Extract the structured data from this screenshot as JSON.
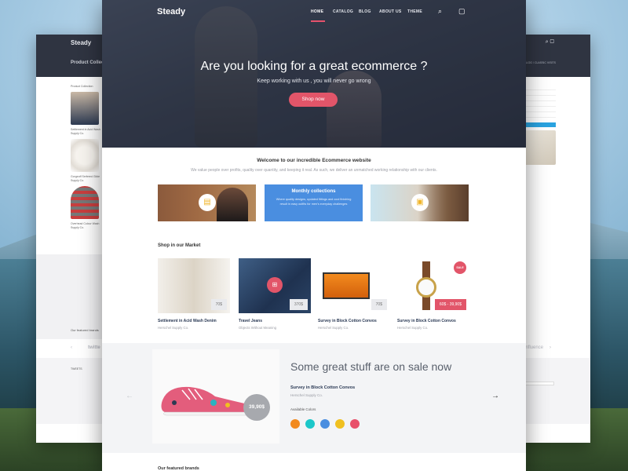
{
  "back_page": {
    "logo": "Steady",
    "title": "Product Collection",
    "icons": "⌕ ▢",
    "breadcrumb": "HOME / BLOG / CLASSIC VISITS",
    "left_label": "Product Collection",
    "items": [
      {
        "name": "Settlement in Acid Wash",
        "brand": "Supply Co."
      },
      {
        "name": "Gorgeoff Serfered Glide",
        "brand": "Supply Co."
      },
      {
        "name": "Overhead Colour Wash",
        "brand": "Supply Co."
      }
    ],
    "brands_label": "Our featured brands",
    "brand_left": "twitte",
    "brand_right": "influence",
    "footer_label": "TWEETS"
  },
  "nav": {
    "logo": "Steady",
    "items": [
      "HOME",
      "CATALOG",
      "BLOG",
      "ABOUT US",
      "THEME"
    ],
    "search_icon": "⌕",
    "bag_icon": "▢"
  },
  "hero": {
    "title": "Are you looking for a great ecommerce ?",
    "subtitle": "Keep working with us , you will never go wrong",
    "button": "Shop now"
  },
  "welcome": {
    "title": "Welcome to our incredible Ecommerce website",
    "text": "We value people over profits, quality over quantity, and keeping it real. As such, we deliver an unmatched working relationship with our clients."
  },
  "features": {
    "left_icon": "▤",
    "middle_title": "Monthly collections",
    "middle_text": "Where quality designs, updated fittings and cool finishing result in easy outfits for men's everyday challenges",
    "right_icon": "▣"
  },
  "market": {
    "label": "Shop in our Market",
    "products": [
      {
        "name": "Settlement in Acid Wash Denim",
        "brand": "Herschel Supply Co.",
        "price": "70$"
      },
      {
        "name": "Travel Jeans",
        "brand": "Objects Without Meaning",
        "price": "370$"
      },
      {
        "name": "Survey in Block Cotton Convos",
        "brand": "Herschel Supply Co.",
        "price": "70$"
      },
      {
        "name": "Survey in Block Cotton Convos",
        "brand": "Herschel Supply Co.",
        "price": "60$ - 39,90$"
      }
    ],
    "sale_badge": "SALE",
    "cart_icon": "⊞"
  },
  "sale": {
    "title": "Some great stuff are on sale now",
    "product": "Survey in Block Cotton Convos",
    "brand": "Herschel Supply Co.",
    "colors_label": "Available Colors",
    "price": "39,90$",
    "prev_arrow": "←",
    "next_arrow": "→",
    "colors": [
      "#f28a1f",
      "#1cc7c9",
      "#4a8ee0",
      "#f0c020",
      "#e8506a"
    ]
  },
  "brands": {
    "label": "Our featured brands"
  }
}
